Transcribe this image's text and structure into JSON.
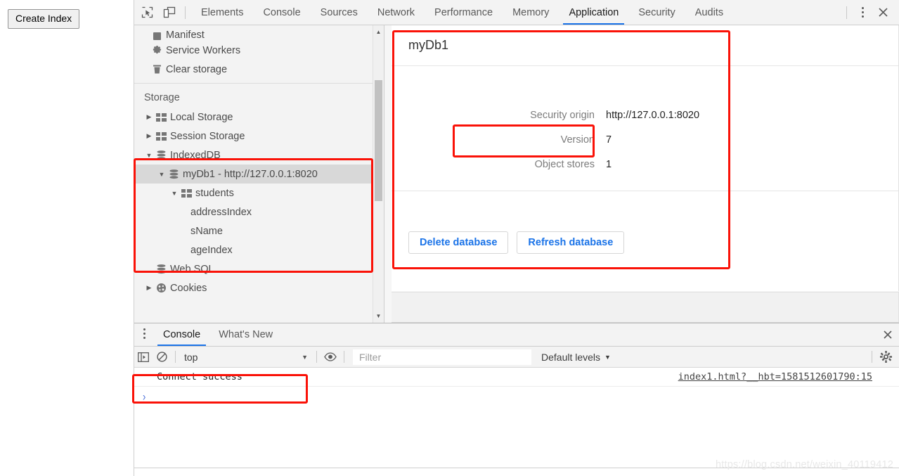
{
  "page": {
    "create_index_button": "Create Index"
  },
  "devtools": {
    "toolbar": {
      "inspect_icon": "inspect-cursor-icon",
      "device_icon": "device-toolbar-icon",
      "more_icon": "kebab-menu-icon",
      "close_icon": "close-icon",
      "tabs": [
        {
          "label": "Elements",
          "active": false
        },
        {
          "label": "Console",
          "active": false
        },
        {
          "label": "Sources",
          "active": false
        },
        {
          "label": "Network",
          "active": false
        },
        {
          "label": "Performance",
          "active": false
        },
        {
          "label": "Memory",
          "active": false
        },
        {
          "label": "Application",
          "active": true
        },
        {
          "label": "Security",
          "active": false
        },
        {
          "label": "Audits",
          "active": false
        }
      ]
    },
    "sidebar": {
      "application_items": [
        {
          "label": "Manifest",
          "icon": "manifest-icon"
        },
        {
          "label": "Service Workers",
          "icon": "gear-icon"
        },
        {
          "label": "Clear storage",
          "icon": "trash-icon"
        }
      ],
      "storage_heading": "Storage",
      "storage_items": [
        {
          "label": "Local Storage",
          "icon": "table-icon",
          "arrow": "collapsed",
          "indent": 0
        },
        {
          "label": "Session Storage",
          "icon": "table-icon",
          "arrow": "collapsed",
          "indent": 0
        },
        {
          "label": "IndexedDB",
          "icon": "database-icon",
          "arrow": "expanded",
          "indent": 0
        },
        {
          "label": "myDb1 - http://127.0.0.1:8020",
          "icon": "database-icon",
          "arrow": "expanded",
          "indent": 1,
          "selected": true
        },
        {
          "label": "students",
          "icon": "table-icon",
          "arrow": "expanded",
          "indent": 2
        },
        {
          "label": "addressIndex",
          "icon": "none",
          "arrow": "none",
          "indent": 3
        },
        {
          "label": "sName",
          "icon": "none",
          "arrow": "none",
          "indent": 3
        },
        {
          "label": "ageIndex",
          "icon": "none",
          "arrow": "none",
          "indent": 3
        },
        {
          "label": "Web SQL",
          "icon": "database-icon",
          "arrow": "none",
          "indent": 0
        },
        {
          "label": "Cookies",
          "icon": "cookie-icon",
          "arrow": "collapsed",
          "indent": 0
        }
      ],
      "scroll_up_icon": "scroll-up-arrow-icon",
      "scroll_down_icon": "scroll-down-arrow-icon"
    },
    "database_panel": {
      "title": "myDb1",
      "fields": [
        {
          "key": "Security origin",
          "value": "http://127.0.0.1:8020"
        },
        {
          "key": "Version",
          "value": "7"
        },
        {
          "key": "Object stores",
          "value": "1"
        }
      ],
      "delete_button": "Delete database",
      "refresh_button": "Refresh database"
    },
    "drawer": {
      "more_icon": "kebab-menu-icon",
      "tabs": [
        {
          "label": "Console",
          "active": true
        },
        {
          "label": "What's New",
          "active": false
        }
      ],
      "close_icon": "close-icon",
      "toolbar": {
        "sidebar_toggle_icon": "console-sidebar-icon",
        "clear_icon": "clear-console-icon",
        "context_value": "top",
        "context_caret": "caret-down-icon",
        "eye_icon": "live-expression-eye-icon",
        "filter_placeholder": "Filter",
        "filter_value": "",
        "levels_label": "Default levels",
        "levels_caret": "caret-down-icon",
        "settings_icon": "gear-icon"
      },
      "messages": [
        {
          "text": "Connect success",
          "source": "index1.html?__hbt=1581512601790:15"
        }
      ],
      "prompt_symbol": "›"
    }
  },
  "watermark": "https://blog.csdn.net/weixin_40119412",
  "colors": {
    "accent_blue": "#1a73e8",
    "annotation_red": "#fa1208",
    "panel_gray": "#f3f3f3",
    "selected_row": "#d8d8d8"
  }
}
